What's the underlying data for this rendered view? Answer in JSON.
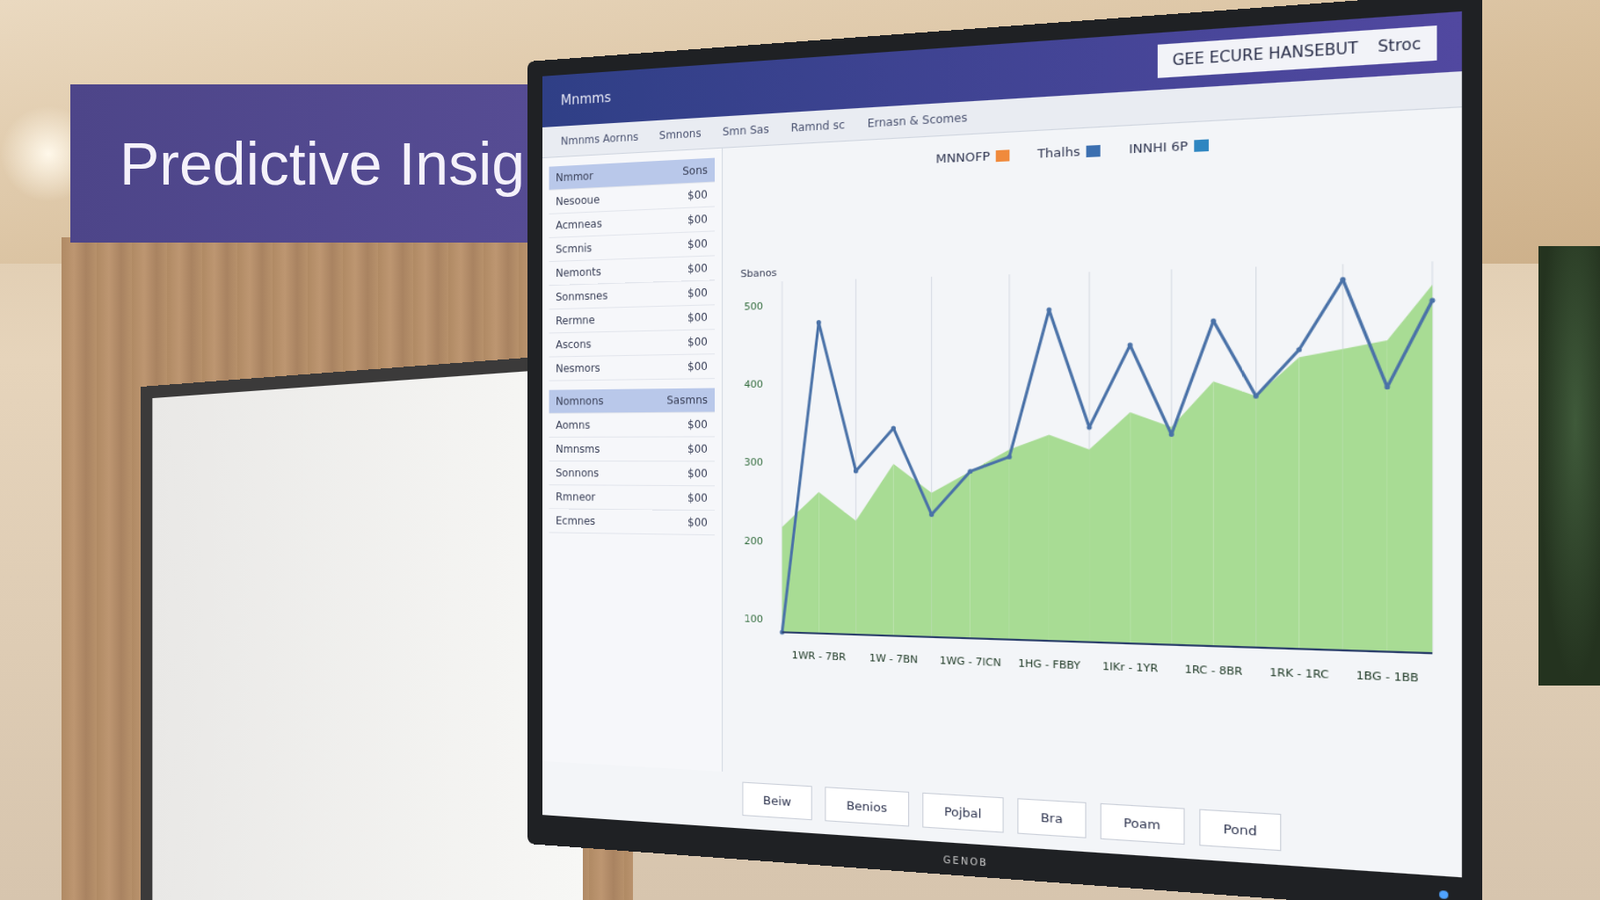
{
  "sign": {
    "title": "Predictive Insights"
  },
  "monitor": {
    "brand": "GENOB",
    "header": {
      "nav": [
        "Mnmms"
      ],
      "title": "GEE ECURE HANSEBUT",
      "action": "Stroc"
    },
    "toolbar": [
      "Nmnms Aornns",
      "Smnons",
      "Smn Sas",
      "Ramnd sc",
      "Ernasn & Scomes"
    ],
    "table": {
      "sections": [
        {
          "header": [
            "Nmmor",
            "Sons"
          ],
          "rows": [
            [
              "Nesooue",
              "$00"
            ],
            [
              "Acmneas",
              "$00"
            ],
            [
              "Scmnis",
              "$00"
            ],
            [
              "Nemonts",
              "$00"
            ],
            [
              "Sonmsnes",
              "$00"
            ],
            [
              "Rermne",
              "$00"
            ],
            [
              "Ascons",
              "$00"
            ],
            [
              "Nesmors",
              "$00"
            ]
          ]
        },
        {
          "header": [
            "Nomnons",
            "Sasmns"
          ],
          "rows": [
            [
              "Aomns",
              "$00"
            ],
            [
              "Nmnsms",
              "$00"
            ],
            [
              "Sonnons",
              "$00"
            ],
            [
              "Rmneor",
              "$00"
            ],
            [
              "Ecmnes",
              "$00"
            ]
          ]
        }
      ]
    },
    "chart": {
      "axis_title": "Sbanos",
      "legend": [
        {
          "label": "MNNOFP",
          "color": "#f08a3c"
        },
        {
          "label": "Thalhs",
          "color": "#3b6fb0"
        },
        {
          "label": "INNHI 6P",
          "color": "#2e86c1"
        }
      ],
      "y_ticks": [
        "500",
        "400",
        "300",
        "200",
        "100"
      ],
      "x_labels": [
        "1WR - 7BR",
        "1W - 7BN",
        "1WG - 7ICN",
        "1HG - FBBY",
        "1IKr - 1YR",
        "1RC - 8BR",
        "1RK - 1RC",
        "1BG - 1BB"
      ],
      "series": [
        {
          "name": "Thalhs",
          "kind": "line",
          "color": "#4a72a8",
          "values": [
            0,
            440,
            230,
            290,
            170,
            230,
            250,
            450,
            290,
            400,
            280,
            430,
            330,
            390,
            480,
            340,
            450
          ]
        },
        {
          "name": "MNNOFP",
          "kind": "area",
          "color": "#a8dc94",
          "values": [
            150,
            200,
            160,
            240,
            200,
            230,
            260,
            280,
            260,
            310,
            290,
            350,
            330,
            380,
            390,
            400,
            470
          ]
        }
      ]
    },
    "buttons": [
      "Beiw",
      "Benios",
      "Pojbal",
      "Bra",
      "Poam",
      "Pond"
    ]
  }
}
